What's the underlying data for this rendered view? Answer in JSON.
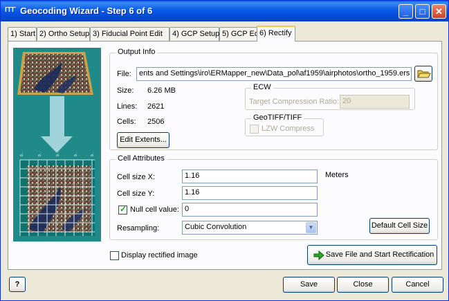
{
  "window": {
    "title": "Geocoding Wizard - Step 6 of 6",
    "icon_text": "ΓΓΓ",
    "controls": {
      "minimize": "_",
      "maximize": "□",
      "close": "✕"
    }
  },
  "tabs": [
    {
      "label": "1) Start"
    },
    {
      "label": "2) Ortho Setup"
    },
    {
      "label": "3) Fiducial Point Edit"
    },
    {
      "label": "4) GCP Setup"
    },
    {
      "label": "5) GCP Edit"
    },
    {
      "label": "6) Rectify",
      "active": true
    }
  ],
  "preview": {
    "grid_tick_labels": [
      "9...",
      "9...",
      "9...",
      "9...",
      "9..."
    ]
  },
  "output_info": {
    "group_title": "Output Info",
    "file_label": "File:",
    "file_value": "ents and Settings\\iro\\ERMapper_new\\Data_pol\\af1959\\airphotos\\ortho_1959.ers",
    "size_label": "Size:",
    "size_value": "6.26  MB",
    "lines_label": "Lines:",
    "lines_value": "2621",
    "cells_label": "Cells:",
    "cells_value": "2506",
    "edit_extents_label": "Edit Extents...",
    "ecw": {
      "group_title": "ECW",
      "ratio_label": "Target Compression Ratio:",
      "ratio_value": "20"
    },
    "geotiff": {
      "group_title": "GeoTIFF/TIFF",
      "lzw_label": "LZW Compress"
    }
  },
  "cell_attributes": {
    "group_title": "Cell Attributes",
    "cell_size_x_label": "Cell size X:",
    "cell_size_x_value": "1.16",
    "units": "Meters",
    "cell_size_y_label": "Cell size Y:",
    "cell_size_y_value": "1.16",
    "null_cell_label": "Null cell value:",
    "null_cell_checked": true,
    "null_cell_value": "0",
    "resampling_label": "Resampling:",
    "resampling_value": "Cubic Convolution",
    "default_cell_size_label": "Default Cell Size"
  },
  "display_rectified_label": "Display rectified image",
  "save_start_label": "Save File and Start Rectification",
  "footer": {
    "help_glyph": "?",
    "save_label": "Save",
    "close_label": "Close",
    "cancel_label": "Cancel"
  },
  "colors": {
    "titlebar": "#0a5ae6",
    "preview_bg": "#1f8a87",
    "trapezoid_fill": "#c9a24a",
    "active_tab_highlight": "#ffc83c"
  }
}
